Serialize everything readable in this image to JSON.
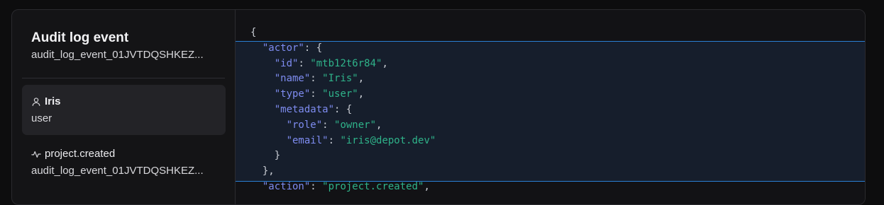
{
  "sidebar": {
    "title": "Audit log event",
    "subtitle": "audit_log_event_01JVTDQSHKEZ...",
    "items": [
      {
        "icon": "user-icon",
        "title": "Iris",
        "subtitle": "user",
        "selected": true
      },
      {
        "icon": "activity-icon",
        "title": "project.created",
        "subtitle": "audit_log_event_01JVTDQSHKEZ...",
        "selected": false
      }
    ]
  },
  "code": {
    "lines": [
      [
        {
          "t": "p",
          "v": "{"
        }
      ],
      [
        {
          "t": "p",
          "v": "  "
        },
        {
          "t": "k",
          "v": "\"actor\""
        },
        {
          "t": "p",
          "v": ": {"
        }
      ],
      [
        {
          "t": "p",
          "v": "    "
        },
        {
          "t": "k",
          "v": "\"id\""
        },
        {
          "t": "p",
          "v": ": "
        },
        {
          "t": "s",
          "v": "\"mtb12t6r84\""
        },
        {
          "t": "p",
          "v": ","
        }
      ],
      [
        {
          "t": "p",
          "v": "    "
        },
        {
          "t": "k",
          "v": "\"name\""
        },
        {
          "t": "p",
          "v": ": "
        },
        {
          "t": "s",
          "v": "\"Iris\""
        },
        {
          "t": "p",
          "v": ","
        }
      ],
      [
        {
          "t": "p",
          "v": "    "
        },
        {
          "t": "k",
          "v": "\"type\""
        },
        {
          "t": "p",
          "v": ": "
        },
        {
          "t": "s",
          "v": "\"user\""
        },
        {
          "t": "p",
          "v": ","
        }
      ],
      [
        {
          "t": "p",
          "v": "    "
        },
        {
          "t": "k",
          "v": "\"metadata\""
        },
        {
          "t": "p",
          "v": ": {"
        }
      ],
      [
        {
          "t": "p",
          "v": "      "
        },
        {
          "t": "k",
          "v": "\"role\""
        },
        {
          "t": "p",
          "v": ": "
        },
        {
          "t": "s",
          "v": "\"owner\""
        },
        {
          "t": "p",
          "v": ","
        }
      ],
      [
        {
          "t": "p",
          "v": "      "
        },
        {
          "t": "k",
          "v": "\"email\""
        },
        {
          "t": "p",
          "v": ": "
        },
        {
          "t": "s",
          "v": "\"iris@depot.dev\""
        }
      ],
      [
        {
          "t": "p",
          "v": "    }"
        }
      ],
      [
        {
          "t": "p",
          "v": "  },"
        }
      ],
      [
        {
          "t": "p",
          "v": "  "
        },
        {
          "t": "k",
          "v": "\"action\""
        },
        {
          "t": "p",
          "v": ": "
        },
        {
          "t": "s",
          "v": "\"project.created\""
        },
        {
          "t": "p",
          "v": ","
        }
      ]
    ],
    "highlighted_section": "actor"
  },
  "colors": {
    "key": "#7e8cf0",
    "string": "#2fb38a",
    "highlight_border": "#2a7fd4"
  }
}
